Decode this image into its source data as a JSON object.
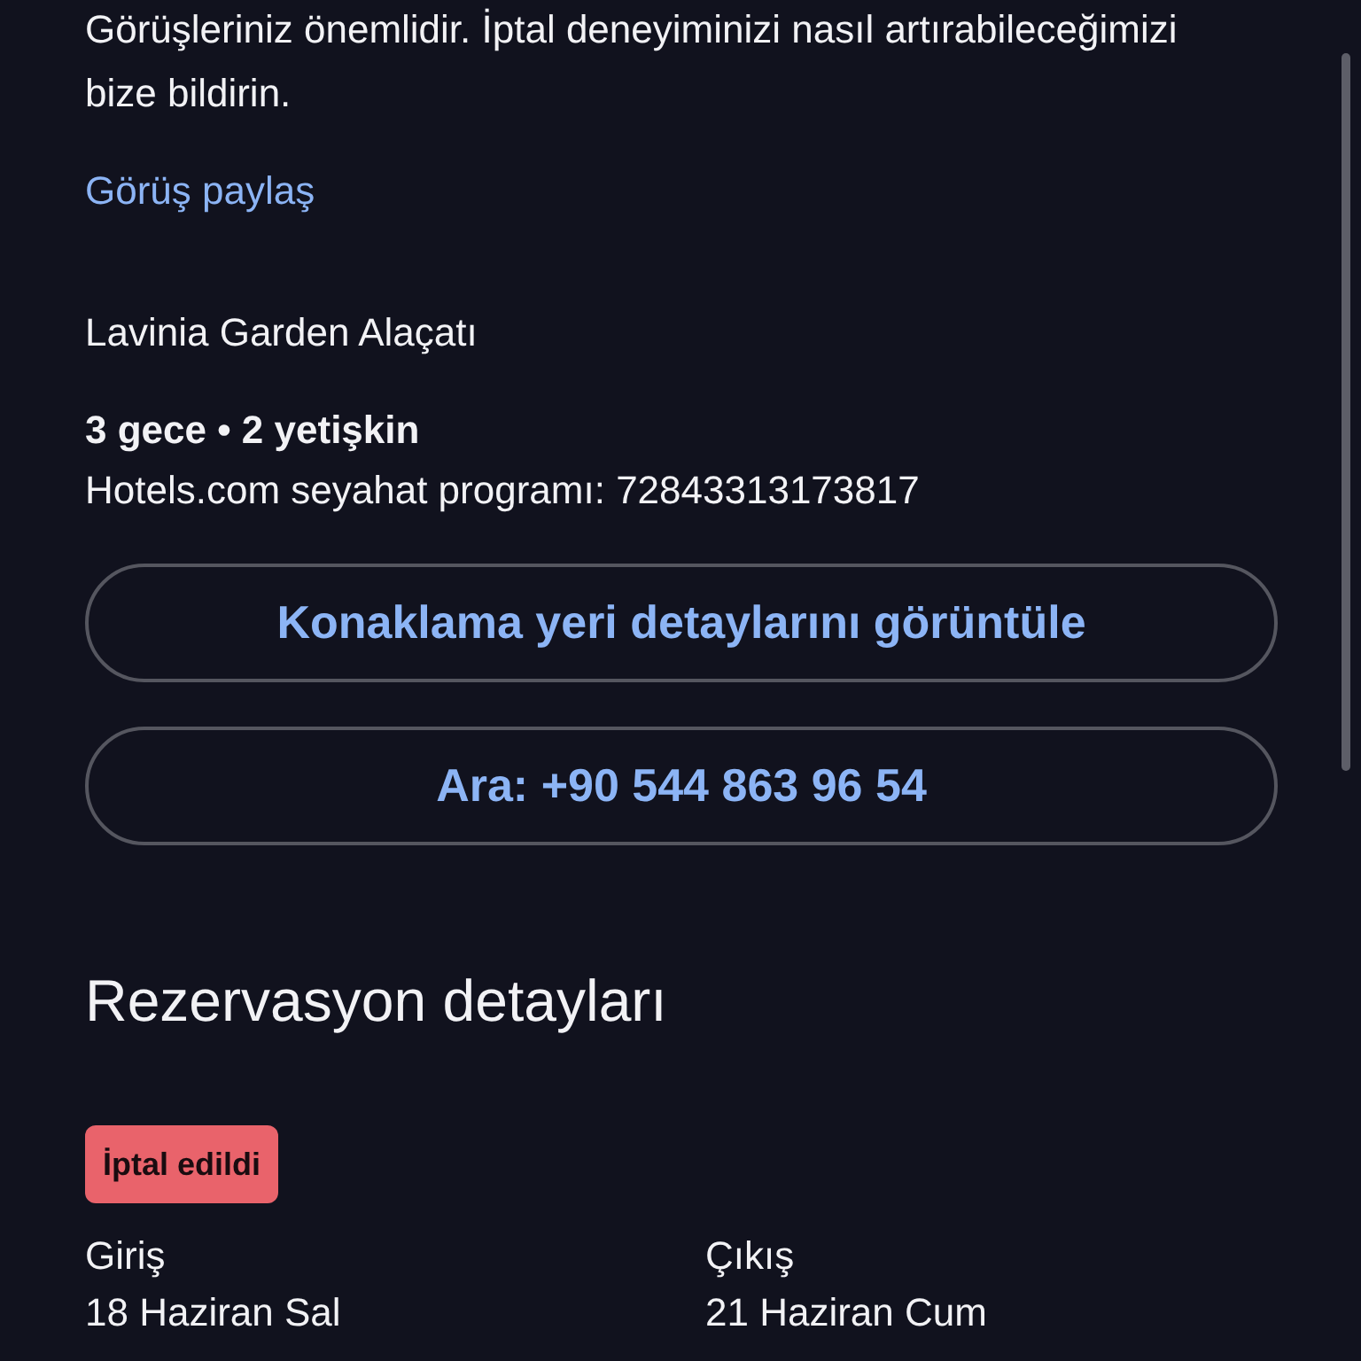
{
  "feedback": {
    "text": "Görüşleriniz önemlidir. İptal deneyiminizi nasıl artırabileceğimizi bize bildirin.",
    "link": "Görüş paylaş"
  },
  "stay": {
    "hotel": "Lavinia Garden Alaçatı",
    "summary": "3 gece • 2 yetişkin",
    "itinerary": "Hotels.com seyahat programı: 72843313173817"
  },
  "buttons": [
    "Konaklama yeri detaylarını görüntüle",
    "Ara: +90 544 863 96 54"
  ],
  "reservation": {
    "heading": "Rezervasyon detayları",
    "status": "İptal edildi",
    "dates": [
      {
        "label": "Giriş",
        "value": "18 Haziran Sal"
      },
      {
        "label": "Çıkış",
        "value": "21 Haziran Cum"
      }
    ]
  }
}
